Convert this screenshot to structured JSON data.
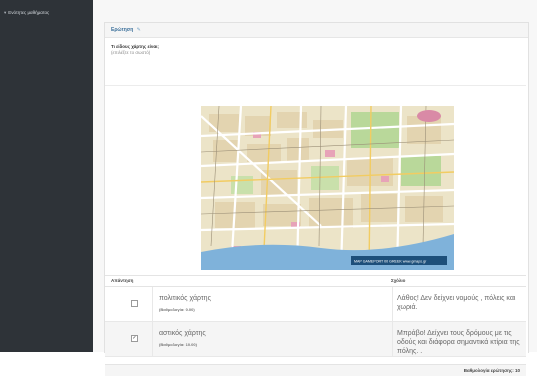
{
  "sidebar": {
    "item_label": "Ενότητες μαθήματος"
  },
  "question": {
    "header_label": "Ερώτηση",
    "edit_icon_label": "✎",
    "text": "Τι είδους χάρτης είναι;",
    "hint": "(επιλέξτε το σωστό)"
  },
  "map": {
    "caption": "ΜΑΡ GAMEPORT 00 GREEK www.gmaps.gr"
  },
  "answers_table": {
    "col_answers": "Απάντηση",
    "col_comments": "Σχόλιο",
    "rows": [
      {
        "checked": "",
        "answer": "πολιτικός χάρτης",
        "score": "(Βαθμολογία: 0.00)",
        "comment": "Λάθος! Δεν δείχνει νομούς , πόλεις και χωριά."
      },
      {
        "checked": "✓",
        "answer": "αστικός χάρτης",
        "score": "(Βαθμολογία: 10.00)",
        "comment": "Μπράβο! Δείχνει τους δρόμους με τις οδούς και διάφορα σημαντικά κτίρια της πόλης. ."
      }
    ]
  },
  "footer": {
    "total_label": "Βαθμολογία ερώτησης: 10"
  },
  "colors": {
    "sidebar_bg": "#2e3338",
    "header_text": "#3a6f9a",
    "map_land": "#ece4c8",
    "map_sea": "#7fb2da",
    "map_roads": "#ffffff",
    "map_green": "#b9d89a"
  }
}
